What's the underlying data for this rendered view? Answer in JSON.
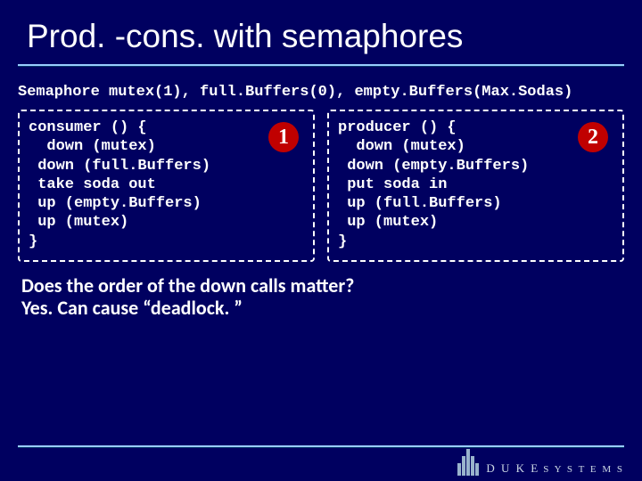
{
  "title": "Prod. -cons. with semaphores",
  "decl": "Semaphore mutex(1), full.Buffers(0), empty.Buffers(Max.Sodas)",
  "consumer": {
    "badge": "1",
    "header": "consumer () {\n  down (mutex)",
    "lines": [
      " down (full.Buffers)",
      "",
      " take soda out",
      "",
      " up (empty.Buffers)",
      "",
      " up (mutex)",
      "}"
    ]
  },
  "producer": {
    "badge": "2",
    "header": "producer () {\n  down (mutex)",
    "lines": [
      " down (empty.Buffers)",
      "",
      " put soda in",
      "",
      " up (full.Buffers)",
      "",
      " up (mutex)",
      "}"
    ]
  },
  "question": {
    "line1": "Does the order of the down calls matter?",
    "line2": "Yes. Can cause “deadlock. ”"
  },
  "logo": {
    "word1": "D U K E",
    "word2": "S Y S T E M S"
  }
}
